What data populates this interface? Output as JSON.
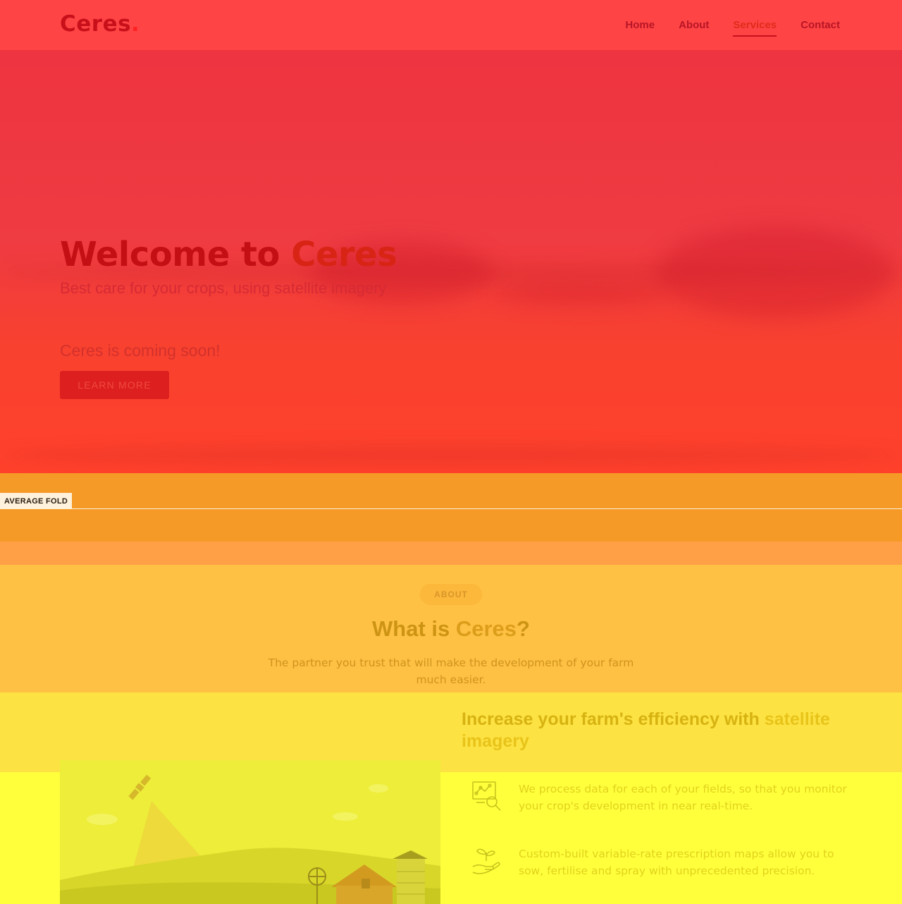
{
  "header": {
    "logo_text": "Ceres",
    "logo_dot": ".",
    "nav": [
      {
        "label": "Home",
        "active": false
      },
      {
        "label": "About",
        "active": false
      },
      {
        "label": "Services",
        "active": true
      },
      {
        "label": "Contact",
        "active": false
      }
    ]
  },
  "hero": {
    "title_prefix": "Welcome to ",
    "title_accent": "Ceres",
    "subtitle": "Best care for your crops, using satellite imagery",
    "coming_soon": "Ceres is coming soon!",
    "button_label": "LEARN MORE"
  },
  "fold": {
    "label": "AVERAGE FOLD"
  },
  "about": {
    "pill": "ABOUT",
    "title_prefix": "What is ",
    "title_accent": "Ceres",
    "title_suffix": "?",
    "description": "The partner you trust that will make the development of your farm much easier."
  },
  "features": {
    "title_prefix": "Increase your farm's efficiency with ",
    "title_accent": "satellite imagery",
    "items": [
      {
        "icon": "monitor-search-icon",
        "text": "We process data for each of your fields, so that you monitor your crop's development in near real-time."
      },
      {
        "icon": "hand-plant-icon",
        "text": "Custom-built variable-rate prescription maps allow you to sow, fertilise and spray with unprecedented precision."
      }
    ]
  },
  "colors": {
    "heat_hot": "#ff4446",
    "heat_warm": "#f59a27",
    "heat_mid": "#ffc143",
    "heat_cool": "#ffff3c"
  }
}
